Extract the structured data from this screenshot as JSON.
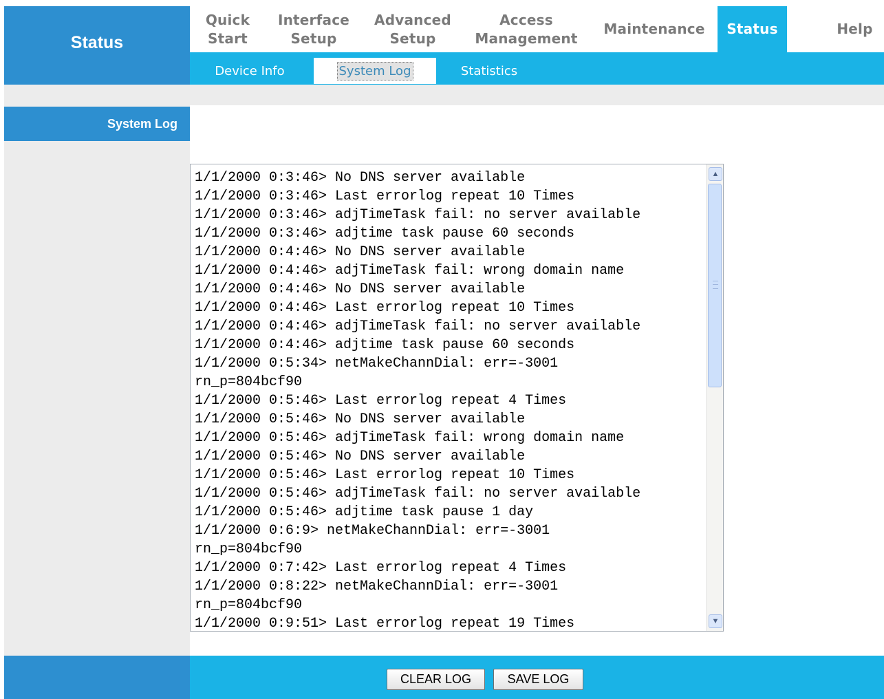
{
  "brand": {
    "title": "Status"
  },
  "nav": {
    "tabs": [
      {
        "line1": "Quick",
        "line2": "Start"
      },
      {
        "line1": "Interface",
        "line2": "Setup"
      },
      {
        "line1": "Advanced",
        "line2": "Setup"
      },
      {
        "line1": "Access",
        "line2": "Management"
      },
      {
        "line1": "Maintenance",
        "line2": ""
      },
      {
        "line1": "Status",
        "line2": "",
        "active": true
      },
      {
        "line1": "Help",
        "line2": ""
      }
    ]
  },
  "subnav": {
    "tabs": [
      {
        "label": "Device Info"
      },
      {
        "label": "System Log",
        "active": true
      },
      {
        "label": "Statistics"
      }
    ]
  },
  "section": {
    "label": "System Log"
  },
  "log": {
    "lines": [
      "1/1/2000 0:3:46> No DNS server available",
      "1/1/2000 0:3:46> Last errorlog repeat 10 Times",
      "1/1/2000 0:3:46> adjTimeTask fail: no server available",
      "1/1/2000 0:3:46> adjtime task pause 60 seconds",
      "1/1/2000 0:4:46> No DNS server available",
      "1/1/2000 0:4:46> adjTimeTask fail: wrong domain name",
      "1/1/2000 0:4:46> No DNS server available",
      "1/1/2000 0:4:46> Last errorlog repeat 10 Times",
      "1/1/2000 0:4:46> adjTimeTask fail: no server available",
      "1/1/2000 0:4:46> adjtime task pause 60 seconds",
      "1/1/2000 0:5:34> netMakeChannDial: err=-3001",
      "rn_p=804bcf90",
      "1/1/2000 0:5:46> Last errorlog repeat 4 Times",
      "1/1/2000 0:5:46> No DNS server available",
      "1/1/2000 0:5:46> adjTimeTask fail: wrong domain name",
      "1/1/2000 0:5:46> No DNS server available",
      "1/1/2000 0:5:46> Last errorlog repeat 10 Times",
      "1/1/2000 0:5:46> adjTimeTask fail: no server available",
      "1/1/2000 0:5:46> adjtime task pause 1 day",
      "1/1/2000 0:6:9> netMakeChannDial: err=-3001",
      "rn_p=804bcf90",
      "1/1/2000 0:7:42> Last errorlog repeat 4 Times",
      "1/1/2000 0:8:22> netMakeChannDial: err=-3001",
      "rn_p=804bcf90",
      "1/1/2000 0:9:51> Last errorlog repeat 19 Times"
    ]
  },
  "buttons": {
    "clear_log": "CLEAR LOG",
    "save_log": "SAVE LOG"
  },
  "icons": {
    "scroll_up": "scroll-up-arrow-icon",
    "scroll_down": "scroll-down-arrow-icon"
  },
  "colors": {
    "brand_blue": "#2d8fd0",
    "accent_cyan": "#1ab3e6",
    "panel_grey": "#ececec"
  }
}
